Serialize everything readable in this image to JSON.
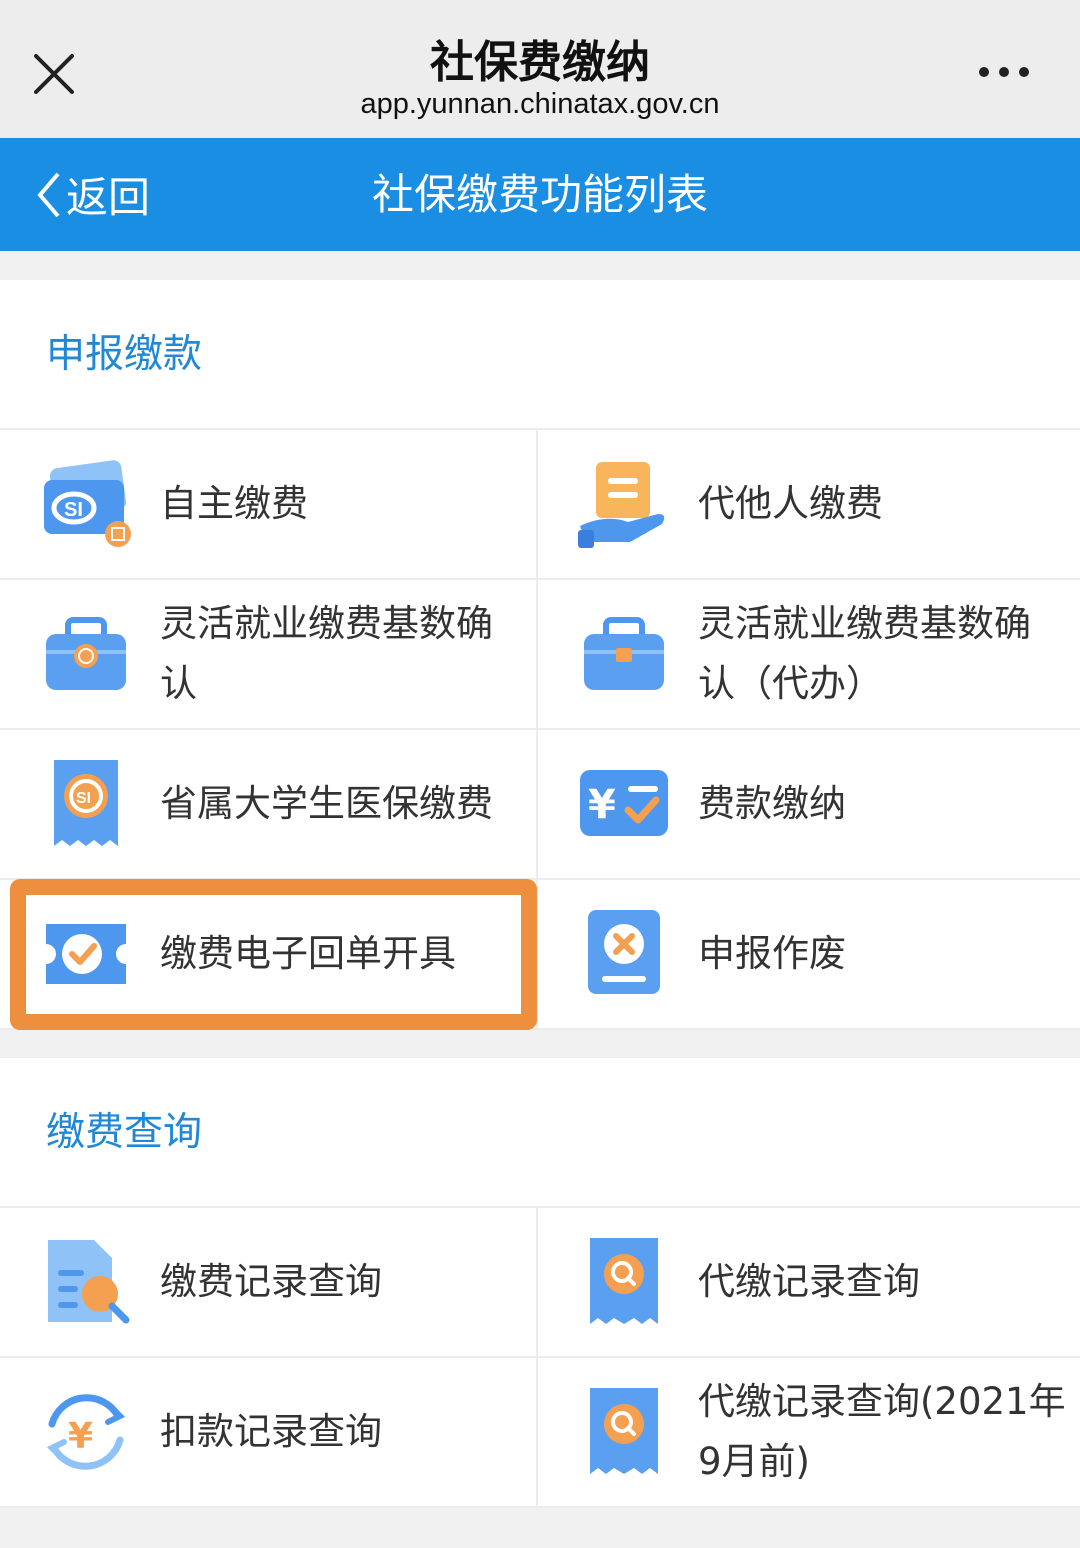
{
  "browser": {
    "page_name": "社保费缴纳",
    "url": "app.yunnan.chinatax.gov.cn",
    "close_icon": "close-icon",
    "more_icon": "more-icon"
  },
  "header": {
    "back_label": "返回",
    "title": "社保缴费功能列表",
    "color": "#1a8ee3"
  },
  "sections": [
    {
      "title": "申报缴款",
      "items": [
        {
          "label": "自主缴费",
          "icon": "social-security-card-icon"
        },
        {
          "label": "代他人缴费",
          "icon": "hand-document-icon"
        },
        {
          "label": "灵活就业缴费基数确认",
          "icon": "briefcase-icon"
        },
        {
          "label": "灵活就业缴费基数确认（代办）",
          "icon": "briefcase-icon"
        },
        {
          "label": "省属大学生医保缴费",
          "icon": "receipt-icon"
        },
        {
          "label": "费款缴纳",
          "icon": "yuan-check-icon"
        },
        {
          "label": "缴费电子回单开具",
          "icon": "ticket-check-icon",
          "highlighted": true
        },
        {
          "label": "申报作废",
          "icon": "cancel-document-icon"
        }
      ]
    },
    {
      "title": "缴费查询",
      "items": [
        {
          "label": "缴费记录查询",
          "icon": "document-search-icon"
        },
        {
          "label": "代缴记录查询",
          "icon": "receipt-search-icon"
        },
        {
          "label": "扣款记录查询",
          "icon": "yuan-refresh-icon"
        },
        {
          "label": "代缴记录查询(2021年9月前)",
          "icon": "receipt-search-icon"
        }
      ]
    }
  ],
  "highlight_color": "#ee8f3d"
}
